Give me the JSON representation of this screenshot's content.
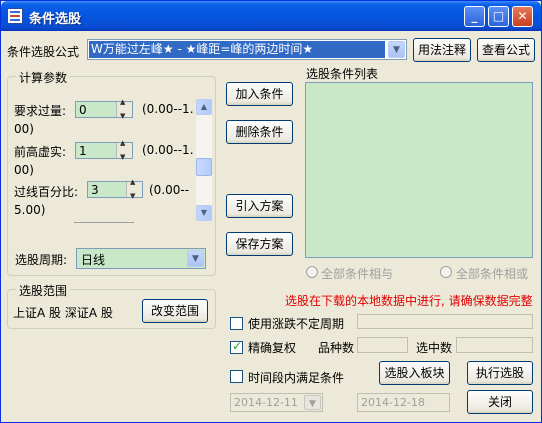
{
  "window": {
    "title": "条件选股",
    "controls": {
      "minimize": "_",
      "maximize": "□",
      "close": "✕"
    }
  },
  "formula": {
    "label": "条件选股公式",
    "selected": "W万能过左峰★ - ★峰距=峰的两边时间★",
    "usage_button": "用法注释",
    "view_button": "查看公式"
  },
  "params": {
    "group_title": "计算参数",
    "items": [
      {
        "label": "要求过量:",
        "value": "0",
        "range_line1": "(0.00--1.",
        "range_line2": "00)"
      },
      {
        "label": "前高虚实:",
        "value": "1",
        "range_line1": "(0.00--1.",
        "range_line2": "00)"
      },
      {
        "label": "过线百分比:",
        "value": "3",
        "range_line1": "(0.00--",
        "range_line2": "5.00)"
      }
    ],
    "period_label": "选股周期:",
    "period_value": "日线"
  },
  "actions": {
    "add": "加入条件",
    "delete": "删除条件",
    "import": "引入方案",
    "save": "保存方案"
  },
  "conditions": {
    "list_title": "选股条件列表",
    "radio_and": "全部条件相与",
    "radio_or": "全部条件相或",
    "note": "选股在下载的本地数据中进行, 请确保数据完整"
  },
  "range": {
    "group_title": "选股范围",
    "text": "上证A 股 深证A 股",
    "change_button": "改变范围"
  },
  "options": {
    "limit_label": "使用涨跌不定周期",
    "limit_checked": false,
    "adjust_label": "精确复权",
    "adjust_checked": true,
    "count_label": "品种数",
    "selected_label": "选中数",
    "period_label": "时间段内满足条件",
    "period_checked": false,
    "date_from": "2014-12-11",
    "date_to": "2014-12-18"
  },
  "bottom_buttons": {
    "to_block": "选股入板块",
    "execute": "执行选股",
    "close": "关闭"
  },
  "colors": {
    "accent": "#0a5fe8",
    "list_bg": "#c8e8c8",
    "note_text": "#e00000"
  }
}
